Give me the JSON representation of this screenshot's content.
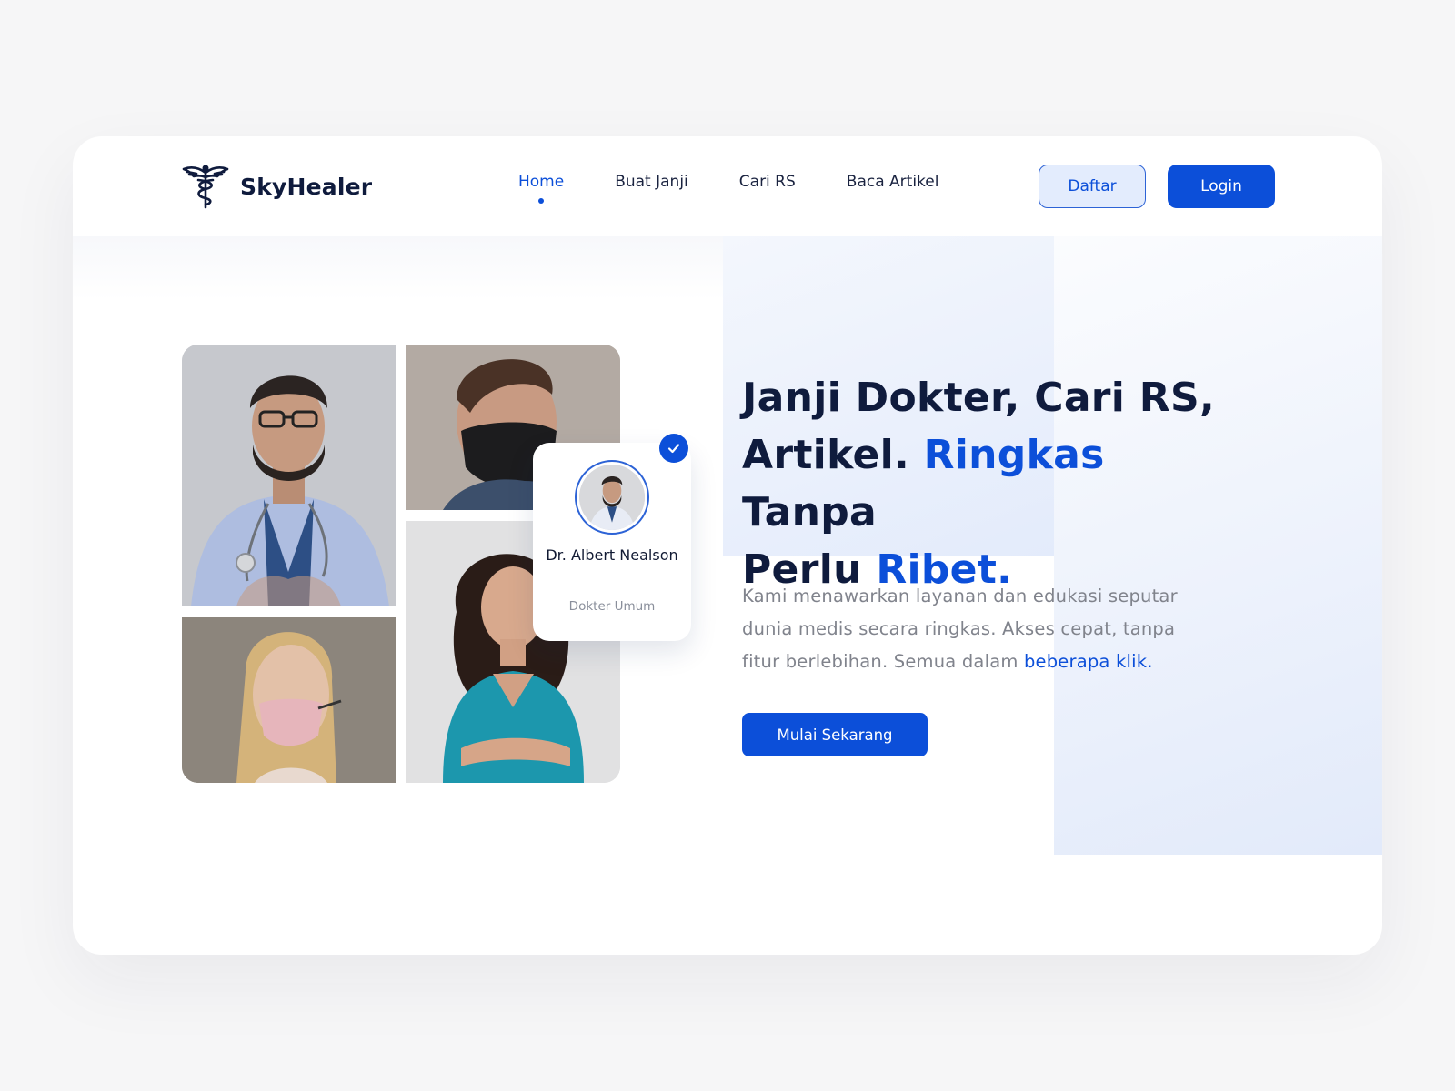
{
  "brand": {
    "name": "SkyHealer",
    "icon": "caduceus-icon"
  },
  "nav": {
    "items": [
      {
        "label": "Home",
        "active": true
      },
      {
        "label": "Buat Janji",
        "active": false
      },
      {
        "label": "Cari RS",
        "active": false
      },
      {
        "label": "Baca Artikel",
        "active": false
      }
    ],
    "register_label": "Daftar",
    "login_label": "Login"
  },
  "hero": {
    "headline": {
      "line1": "Janji Dokter, Cari RS,",
      "line2_a": "Artikel. ",
      "line2_b": "Ringkas",
      "line2_c": " Tanpa",
      "line3_a": "Perlu ",
      "line3_b": "Ribet."
    },
    "description": {
      "text": "Kami menawarkan layanan dan edukasi seputar dunia medis secara ringkas. Akses cepat, tanpa fitur berlebihan. Semua dalam ",
      "link": "beberapa klik."
    },
    "cta_label": "Mulai Sekarang"
  },
  "doctor_card": {
    "name": "Dr. Albert Nealson",
    "specialty": "Dokter Umum",
    "verified_icon": "check-icon"
  },
  "colors": {
    "primary": "#0c4fd9",
    "dark": "#0f1b3d",
    "muted": "#80838c",
    "background": "#f6f6f7"
  }
}
